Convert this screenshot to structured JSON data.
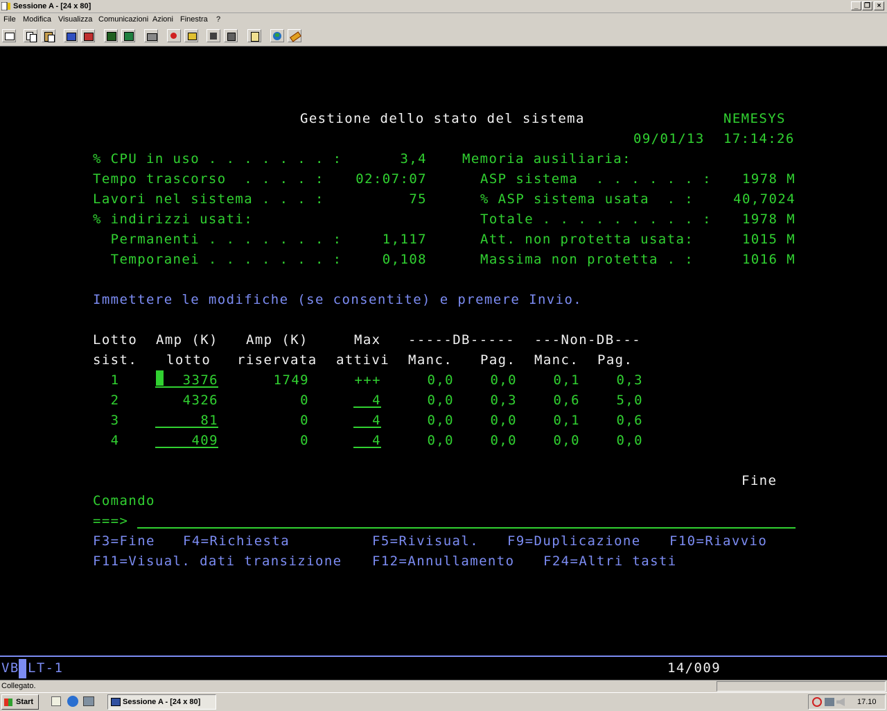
{
  "window": {
    "title": "Sessione A - [24 x 80]",
    "controls": [
      "_",
      "❐",
      "×"
    ]
  },
  "menu": [
    "File",
    "Modifica",
    "Visualizza",
    "Comunicazioni",
    "Azioni",
    "Finestra",
    "?"
  ],
  "toolbar_icons": [
    "print-screen-icon",
    "copy-icon",
    "paste-icon",
    "send-file-icon",
    "receive-file-icon",
    "display-icon",
    "keyboard-map-icon",
    "macro-icon",
    "record-macro-icon",
    "play-macro-icon",
    "stop-macro-icon",
    "clipboard-icon",
    "host-icon",
    "globe-icon",
    "help-icon"
  ],
  "screen": {
    "title": "Gestione dello stato del sistema",
    "system_name": "NEMESYS",
    "date": "09/01/13",
    "time": "17:14:26",
    "left_stats": [
      {
        "label": "% CPU in uso . . . . . . . :",
        "value": "3,4"
      },
      {
        "label": "Tempo trascorso  . . . . :",
        "value": "02:07:07"
      },
      {
        "label": "Lavori nel sistema . . . :",
        "value": "75"
      },
      {
        "label": "% indirizzi usati:",
        "value": ""
      },
      {
        "label": "  Permanenti . . . . . . . :",
        "value": "1,117"
      },
      {
        "label": "  Temporanei . . . . . . . :",
        "value": "0,108"
      }
    ],
    "memory_heading": "Memoria ausiliaria:",
    "right_stats": [
      {
        "label": "ASP sistema  . . . . . . :",
        "value": "1978 M"
      },
      {
        "label": "% ASP sistema usata  . :",
        "value": "40,7024"
      },
      {
        "label": "Totale . . . . . . . . . :",
        "value": "1978 M"
      },
      {
        "label": "Att. non protetta usata:",
        "value": "1015 M"
      },
      {
        "label": "Massima non protetta . :",
        "value": "1016 M"
      }
    ],
    "instruction": "Immettere le modifiche (se consentite) e premere Invio.",
    "table": {
      "header_row1": [
        "Lotto",
        "Amp (K)",
        "Amp (K)",
        "Max",
        "-----DB-----",
        "---Non-DB---"
      ],
      "header_row2": [
        "sist.",
        "lotto",
        "riservata",
        "attivi",
        "Manc.",
        "Pag.",
        "Manc.",
        "Pag."
      ],
      "rows": [
        {
          "pool": "1",
          "size": "3376",
          "reserved": "1749",
          "max_active": "+++",
          "db_fault": "0,0",
          "db_pages": "0,0",
          "ndb_fault": "0,1",
          "ndb_pages": "0,3"
        },
        {
          "pool": "2",
          "size": "4326",
          "reserved": "0",
          "max_active": "4",
          "db_fault": "0,0",
          "db_pages": "0,3",
          "ndb_fault": "0,6",
          "ndb_pages": "5,0"
        },
        {
          "pool": "3",
          "size": "81",
          "reserved": "0",
          "max_active": "4",
          "db_fault": "0,0",
          "db_pages": "0,0",
          "ndb_fault": "0,1",
          "ndb_pages": "0,6"
        },
        {
          "pool": "4",
          "size": "409",
          "reserved": "0",
          "max_active": "4",
          "db_fault": "0,0",
          "db_pages": "0,0",
          "ndb_fault": "0,0",
          "ndb_pages": "0,0"
        }
      ]
    },
    "more_indicator": "Fine",
    "command_label": "Comando",
    "command_prompt": "===>",
    "command_value": "",
    "fkeys_row1": [
      "F3=Fine",
      "F4=Richiesta",
      "F5=Rivisual.",
      "F9=Duplicazione",
      "F10=Riavvio"
    ],
    "fkeys_row2": [
      "F11=Visual. dati transizione",
      "F12=Annullamento",
      "F24=Altri tasti"
    ]
  },
  "oia": {
    "left_a": "VB",
    "left_b": "LT-1",
    "cursor_pos": "14/009"
  },
  "status": {
    "text": "Collegato."
  },
  "taskbar": {
    "start": "Start",
    "task": "Sessione A - [24 x 80]",
    "clock": "17.10"
  }
}
